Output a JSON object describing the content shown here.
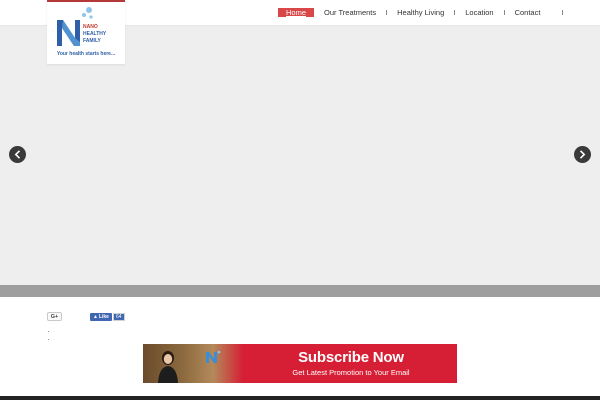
{
  "brand": {
    "name_lines": [
      "N",
      "NANO",
      "HEALTHY",
      "FAMILY"
    ],
    "tagline": "Your health starts here...",
    "accent": "#d94848",
    "logo_blue": "#2f5fa8"
  },
  "nav": {
    "items": [
      {
        "label": "Home",
        "active": true
      },
      {
        "label": "Our Treatments",
        "active": false
      },
      {
        "label": "Healthy Living",
        "active": false
      },
      {
        "label": "Location",
        "active": false
      },
      {
        "label": "Contact",
        "active": false
      }
    ]
  },
  "slider": {
    "prev_icon": "chevron-left-icon",
    "next_icon": "chevron-right-icon"
  },
  "social": {
    "gplus_label": "G+",
    "fb_like_label": "Like",
    "fb_like_count": "64"
  },
  "subscribe": {
    "title": "Subscribe Now",
    "subtitle": "Get Latest Promotion to Your Email",
    "color": "#d61f35"
  }
}
